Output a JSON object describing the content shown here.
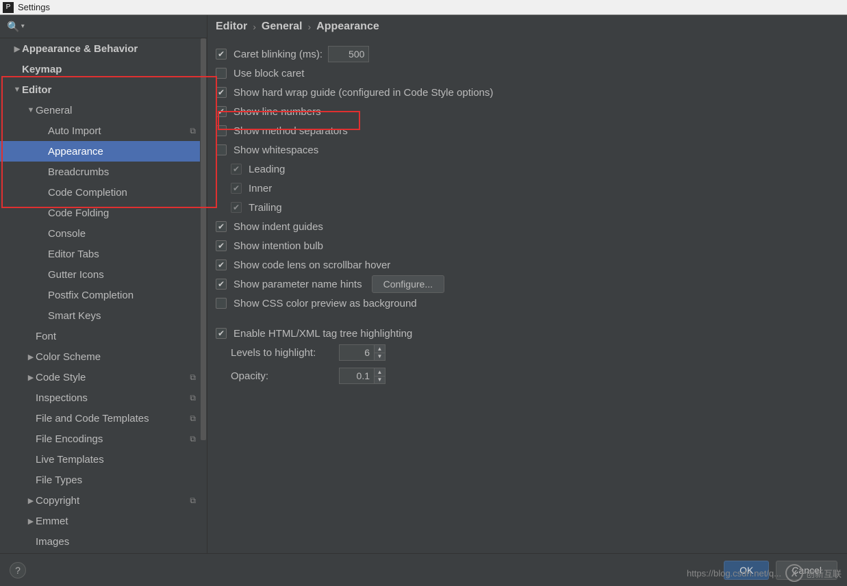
{
  "window": {
    "title": "Settings"
  },
  "breadcrumb": [
    "Editor",
    "General",
    "Appearance"
  ],
  "sidebar": {
    "items": [
      {
        "label": "Appearance & Behavior",
        "indent": 0,
        "arrow": "collapsed",
        "bold": true
      },
      {
        "label": "Keymap",
        "indent": 0,
        "arrow": "none",
        "bold": true
      },
      {
        "label": "Editor",
        "indent": 0,
        "arrow": "expanded",
        "bold": true
      },
      {
        "label": "General",
        "indent": 1,
        "arrow": "expanded",
        "bold": false
      },
      {
        "label": "Auto Import",
        "indent": 2,
        "arrow": "none",
        "copy": true
      },
      {
        "label": "Appearance",
        "indent": 2,
        "arrow": "none",
        "selected": true
      },
      {
        "label": "Breadcrumbs",
        "indent": 2,
        "arrow": "none"
      },
      {
        "label": "Code Completion",
        "indent": 2,
        "arrow": "none"
      },
      {
        "label": "Code Folding",
        "indent": 2,
        "arrow": "none"
      },
      {
        "label": "Console",
        "indent": 2,
        "arrow": "none"
      },
      {
        "label": "Editor Tabs",
        "indent": 2,
        "arrow": "none"
      },
      {
        "label": "Gutter Icons",
        "indent": 2,
        "arrow": "none"
      },
      {
        "label": "Postfix Completion",
        "indent": 2,
        "arrow": "none"
      },
      {
        "label": "Smart Keys",
        "indent": 2,
        "arrow": "none"
      },
      {
        "label": "Font",
        "indent": 1,
        "arrow": "none"
      },
      {
        "label": "Color Scheme",
        "indent": 1,
        "arrow": "collapsed"
      },
      {
        "label": "Code Style",
        "indent": 1,
        "arrow": "collapsed",
        "copy": true
      },
      {
        "label": "Inspections",
        "indent": 1,
        "arrow": "none",
        "copy": true
      },
      {
        "label": "File and Code Templates",
        "indent": 1,
        "arrow": "none",
        "copy": true
      },
      {
        "label": "File Encodings",
        "indent": 1,
        "arrow": "none",
        "copy": true
      },
      {
        "label": "Live Templates",
        "indent": 1,
        "arrow": "none"
      },
      {
        "label": "File Types",
        "indent": 1,
        "arrow": "none"
      },
      {
        "label": "Copyright",
        "indent": 1,
        "arrow": "collapsed",
        "copy": true
      },
      {
        "label": "Emmet",
        "indent": 1,
        "arrow": "collapsed"
      },
      {
        "label": "Images",
        "indent": 1,
        "arrow": "none"
      }
    ]
  },
  "settings": {
    "caret_label": "Caret blinking (ms):",
    "caret_value": "500",
    "block_caret": "Use block caret",
    "hard_wrap": "Show hard wrap guide (configured in Code Style options)",
    "line_numbers": "Show line numbers",
    "method_sep": "Show method separators",
    "whitespaces": "Show whitespaces",
    "ws_leading": "Leading",
    "ws_inner": "Inner",
    "ws_trailing": "Trailing",
    "indent_guides": "Show indent guides",
    "intention_bulb": "Show intention bulb",
    "code_lens": "Show code lens on scrollbar hover",
    "param_hints": "Show parameter name hints",
    "configure_btn": "Configure...",
    "css_preview": "Show CSS color preview as background",
    "tag_tree": "Enable HTML/XML tag tree highlighting",
    "levels_label": "Levels to highlight:",
    "levels_value": "6",
    "opacity_label": "Opacity:",
    "opacity_value": "0.1"
  },
  "footer": {
    "ok": "OK",
    "cancel": "Cancel"
  },
  "watermark": {
    "url": "https://blog.csdn.net/q...",
    "brand": "创新互联"
  }
}
